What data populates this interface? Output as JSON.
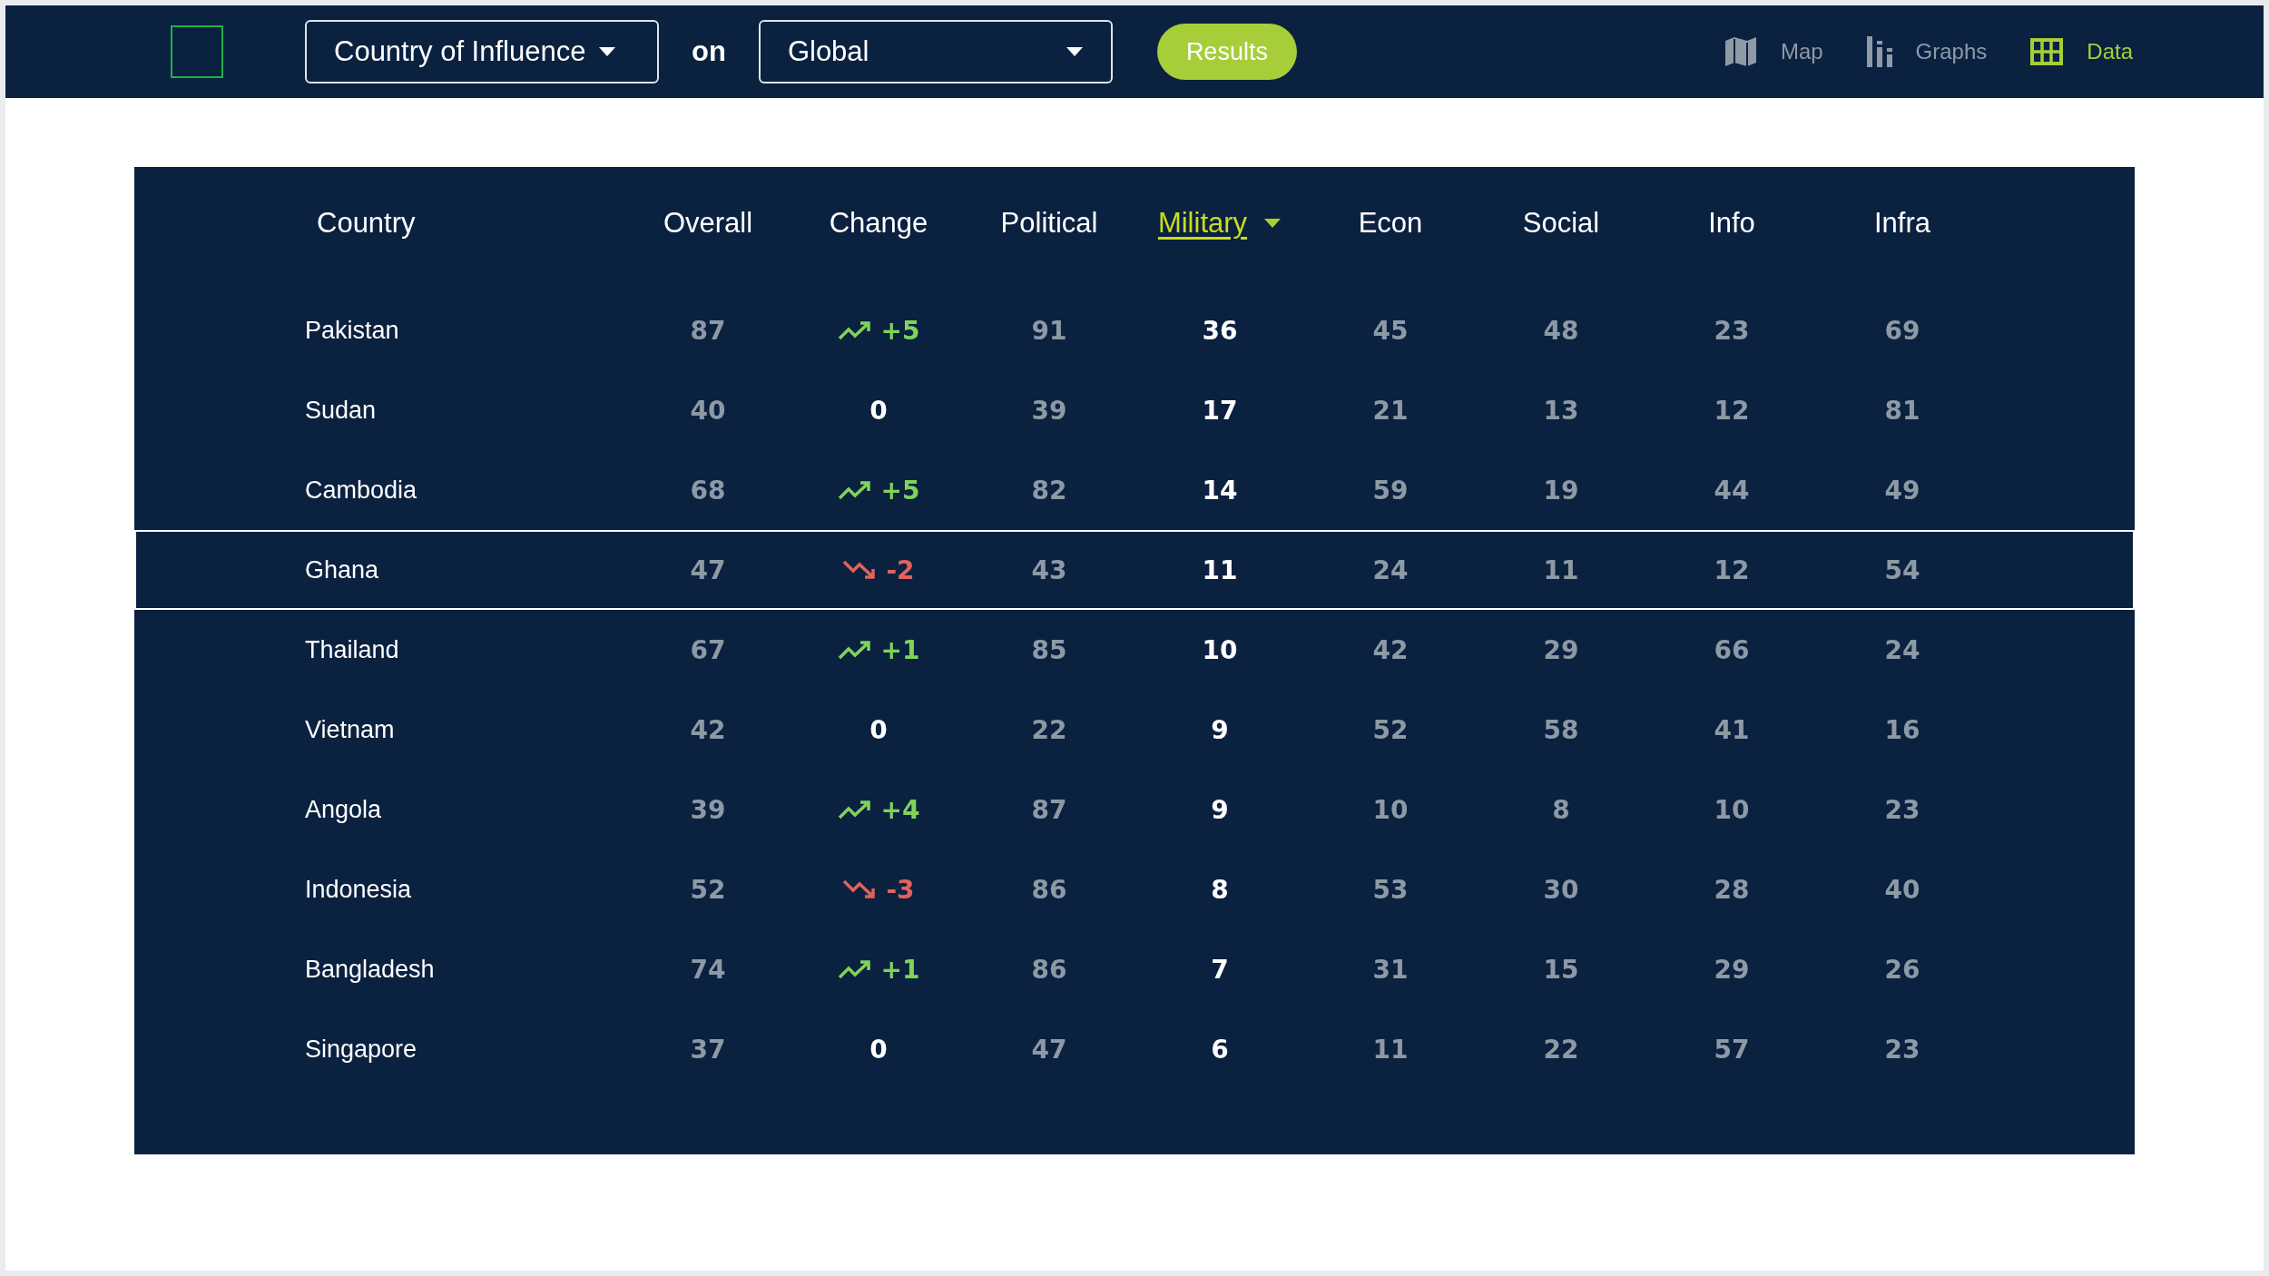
{
  "toolbar": {
    "metric_dropdown": {
      "value": "Country of Influence"
    },
    "connector": "on",
    "region_dropdown": {
      "value": "Global"
    },
    "results_button": "Results"
  },
  "nav": [
    {
      "kind": "map",
      "label": "Map",
      "selected": false
    },
    {
      "kind": "graphs",
      "label": "Graphs",
      "selected": false
    },
    {
      "kind": "data",
      "label": "Data",
      "selected": true
    }
  ],
  "table": {
    "columns": [
      {
        "label": "Country",
        "sorted": false
      },
      {
        "label": "Overall",
        "sorted": false
      },
      {
        "label": "Change",
        "sorted": false
      },
      {
        "label": "Political",
        "sorted": false
      },
      {
        "label": "Military",
        "sorted": true
      },
      {
        "label": "Econ",
        "sorted": false
      },
      {
        "label": "Social",
        "sorted": false
      },
      {
        "label": "Info",
        "sorted": false
      },
      {
        "label": "Infra",
        "sorted": false
      }
    ],
    "rows": [
      {
        "country": "Pakistan",
        "overall": "87",
        "change": {
          "kind": "up",
          "value": "+5"
        },
        "political": "91",
        "military": "36",
        "econ": "45",
        "social": "48",
        "info": "23",
        "infra": "69",
        "selected": false
      },
      {
        "country": "Sudan",
        "overall": "40",
        "change": {
          "kind": "none",
          "value": "0"
        },
        "political": "39",
        "military": "17",
        "econ": "21",
        "social": "13",
        "info": "12",
        "infra": "81",
        "selected": false
      },
      {
        "country": "Cambodia",
        "overall": "68",
        "change": {
          "kind": "up",
          "value": "+5"
        },
        "political": "82",
        "military": "14",
        "econ": "59",
        "social": "19",
        "info": "44",
        "infra": "49",
        "selected": false
      },
      {
        "country": "Ghana",
        "overall": "47",
        "change": {
          "kind": "down",
          "value": "-2"
        },
        "political": "43",
        "military": "11",
        "econ": "24",
        "social": "11",
        "info": "12",
        "infra": "54",
        "selected": true
      },
      {
        "country": "Thailand",
        "overall": "67",
        "change": {
          "kind": "up",
          "value": "+1"
        },
        "political": "85",
        "military": "10",
        "econ": "42",
        "social": "29",
        "info": "66",
        "infra": "24",
        "selected": false
      },
      {
        "country": "Vietnam",
        "overall": "42",
        "change": {
          "kind": "none",
          "value": "0"
        },
        "political": "22",
        "military": "9",
        "econ": "52",
        "social": "58",
        "info": "41",
        "infra": "16",
        "selected": false
      },
      {
        "country": "Angola",
        "overall": "39",
        "change": {
          "kind": "up",
          "value": "+4"
        },
        "political": "87",
        "military": "9",
        "econ": "10",
        "social": "8",
        "info": "10",
        "infra": "23",
        "selected": false
      },
      {
        "country": "Indonesia",
        "overall": "52",
        "change": {
          "kind": "down",
          "value": "-3"
        },
        "political": "86",
        "military": "8",
        "econ": "53",
        "social": "30",
        "info": "28",
        "infra": "40",
        "selected": false
      },
      {
        "country": "Bangladesh",
        "overall": "74",
        "change": {
          "kind": "up",
          "value": "+1"
        },
        "political": "86",
        "military": "7",
        "econ": "31",
        "social": "15",
        "info": "29",
        "infra": "26",
        "selected": false
      },
      {
        "country": "Singapore",
        "overall": "37",
        "change": {
          "kind": "none",
          "value": "0"
        },
        "political": "47",
        "military": "6",
        "econ": "11",
        "social": "22",
        "info": "57",
        "infra": "23",
        "selected": false
      }
    ]
  }
}
